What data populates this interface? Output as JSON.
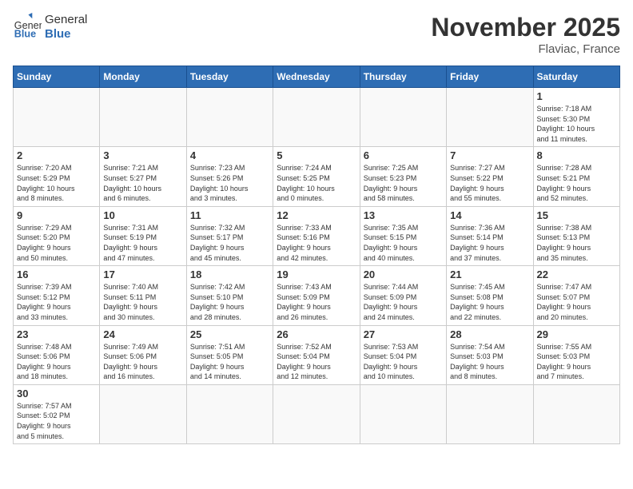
{
  "header": {
    "logo_general": "General",
    "logo_blue": "Blue",
    "month_title": "November 2025",
    "location": "Flaviac, France"
  },
  "days_of_week": [
    "Sunday",
    "Monday",
    "Tuesday",
    "Wednesday",
    "Thursday",
    "Friday",
    "Saturday"
  ],
  "weeks": [
    [
      {
        "day": "",
        "info": ""
      },
      {
        "day": "",
        "info": ""
      },
      {
        "day": "",
        "info": ""
      },
      {
        "day": "",
        "info": ""
      },
      {
        "day": "",
        "info": ""
      },
      {
        "day": "",
        "info": ""
      },
      {
        "day": "1",
        "info": "Sunrise: 7:18 AM\nSunset: 5:30 PM\nDaylight: 10 hours\nand 11 minutes."
      }
    ],
    [
      {
        "day": "2",
        "info": "Sunrise: 7:20 AM\nSunset: 5:29 PM\nDaylight: 10 hours\nand 8 minutes."
      },
      {
        "day": "3",
        "info": "Sunrise: 7:21 AM\nSunset: 5:27 PM\nDaylight: 10 hours\nand 6 minutes."
      },
      {
        "day": "4",
        "info": "Sunrise: 7:23 AM\nSunset: 5:26 PM\nDaylight: 10 hours\nand 3 minutes."
      },
      {
        "day": "5",
        "info": "Sunrise: 7:24 AM\nSunset: 5:25 PM\nDaylight: 10 hours\nand 0 minutes."
      },
      {
        "day": "6",
        "info": "Sunrise: 7:25 AM\nSunset: 5:23 PM\nDaylight: 9 hours\nand 58 minutes."
      },
      {
        "day": "7",
        "info": "Sunrise: 7:27 AM\nSunset: 5:22 PM\nDaylight: 9 hours\nand 55 minutes."
      },
      {
        "day": "8",
        "info": "Sunrise: 7:28 AM\nSunset: 5:21 PM\nDaylight: 9 hours\nand 52 minutes."
      }
    ],
    [
      {
        "day": "9",
        "info": "Sunrise: 7:29 AM\nSunset: 5:20 PM\nDaylight: 9 hours\nand 50 minutes."
      },
      {
        "day": "10",
        "info": "Sunrise: 7:31 AM\nSunset: 5:19 PM\nDaylight: 9 hours\nand 47 minutes."
      },
      {
        "day": "11",
        "info": "Sunrise: 7:32 AM\nSunset: 5:17 PM\nDaylight: 9 hours\nand 45 minutes."
      },
      {
        "day": "12",
        "info": "Sunrise: 7:33 AM\nSunset: 5:16 PM\nDaylight: 9 hours\nand 42 minutes."
      },
      {
        "day": "13",
        "info": "Sunrise: 7:35 AM\nSunset: 5:15 PM\nDaylight: 9 hours\nand 40 minutes."
      },
      {
        "day": "14",
        "info": "Sunrise: 7:36 AM\nSunset: 5:14 PM\nDaylight: 9 hours\nand 37 minutes."
      },
      {
        "day": "15",
        "info": "Sunrise: 7:38 AM\nSunset: 5:13 PM\nDaylight: 9 hours\nand 35 minutes."
      }
    ],
    [
      {
        "day": "16",
        "info": "Sunrise: 7:39 AM\nSunset: 5:12 PM\nDaylight: 9 hours\nand 33 minutes."
      },
      {
        "day": "17",
        "info": "Sunrise: 7:40 AM\nSunset: 5:11 PM\nDaylight: 9 hours\nand 30 minutes."
      },
      {
        "day": "18",
        "info": "Sunrise: 7:42 AM\nSunset: 5:10 PM\nDaylight: 9 hours\nand 28 minutes."
      },
      {
        "day": "19",
        "info": "Sunrise: 7:43 AM\nSunset: 5:09 PM\nDaylight: 9 hours\nand 26 minutes."
      },
      {
        "day": "20",
        "info": "Sunrise: 7:44 AM\nSunset: 5:09 PM\nDaylight: 9 hours\nand 24 minutes."
      },
      {
        "day": "21",
        "info": "Sunrise: 7:45 AM\nSunset: 5:08 PM\nDaylight: 9 hours\nand 22 minutes."
      },
      {
        "day": "22",
        "info": "Sunrise: 7:47 AM\nSunset: 5:07 PM\nDaylight: 9 hours\nand 20 minutes."
      }
    ],
    [
      {
        "day": "23",
        "info": "Sunrise: 7:48 AM\nSunset: 5:06 PM\nDaylight: 9 hours\nand 18 minutes."
      },
      {
        "day": "24",
        "info": "Sunrise: 7:49 AM\nSunset: 5:06 PM\nDaylight: 9 hours\nand 16 minutes."
      },
      {
        "day": "25",
        "info": "Sunrise: 7:51 AM\nSunset: 5:05 PM\nDaylight: 9 hours\nand 14 minutes."
      },
      {
        "day": "26",
        "info": "Sunrise: 7:52 AM\nSunset: 5:04 PM\nDaylight: 9 hours\nand 12 minutes."
      },
      {
        "day": "27",
        "info": "Sunrise: 7:53 AM\nSunset: 5:04 PM\nDaylight: 9 hours\nand 10 minutes."
      },
      {
        "day": "28",
        "info": "Sunrise: 7:54 AM\nSunset: 5:03 PM\nDaylight: 9 hours\nand 8 minutes."
      },
      {
        "day": "29",
        "info": "Sunrise: 7:55 AM\nSunset: 5:03 PM\nDaylight: 9 hours\nand 7 minutes."
      }
    ],
    [
      {
        "day": "30",
        "info": "Sunrise: 7:57 AM\nSunset: 5:02 PM\nDaylight: 9 hours\nand 5 minutes."
      },
      {
        "day": "",
        "info": ""
      },
      {
        "day": "",
        "info": ""
      },
      {
        "day": "",
        "info": ""
      },
      {
        "day": "",
        "info": ""
      },
      {
        "day": "",
        "info": ""
      },
      {
        "day": "",
        "info": ""
      }
    ]
  ]
}
